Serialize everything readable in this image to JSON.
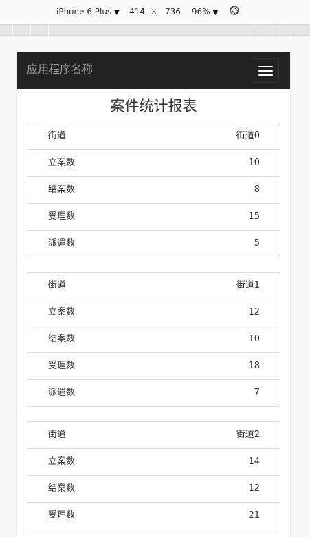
{
  "devtools": {
    "device": "iPhone 6 Plus",
    "width": "414",
    "times": "×",
    "height": "736",
    "zoom": "96%"
  },
  "app": {
    "brand": "应用程序名称",
    "title": "案件统计报表"
  },
  "panels": [
    {
      "rows": [
        {
          "label": "街道",
          "value": "街道0"
        },
        {
          "label": "立案数",
          "value": "10"
        },
        {
          "label": "结案数",
          "value": "8"
        },
        {
          "label": "受理数",
          "value": "15"
        },
        {
          "label": "派遣数",
          "value": "5"
        }
      ]
    },
    {
      "rows": [
        {
          "label": "街道",
          "value": "街道1"
        },
        {
          "label": "立案数",
          "value": "12"
        },
        {
          "label": "结案数",
          "value": "10"
        },
        {
          "label": "受理数",
          "value": "18"
        },
        {
          "label": "派遣数",
          "value": "7"
        }
      ]
    },
    {
      "rows": [
        {
          "label": "街道",
          "value": "街道2"
        },
        {
          "label": "立案数",
          "value": "14"
        },
        {
          "label": "结案数",
          "value": "12"
        },
        {
          "label": "受理数",
          "value": "21"
        }
      ]
    }
  ]
}
